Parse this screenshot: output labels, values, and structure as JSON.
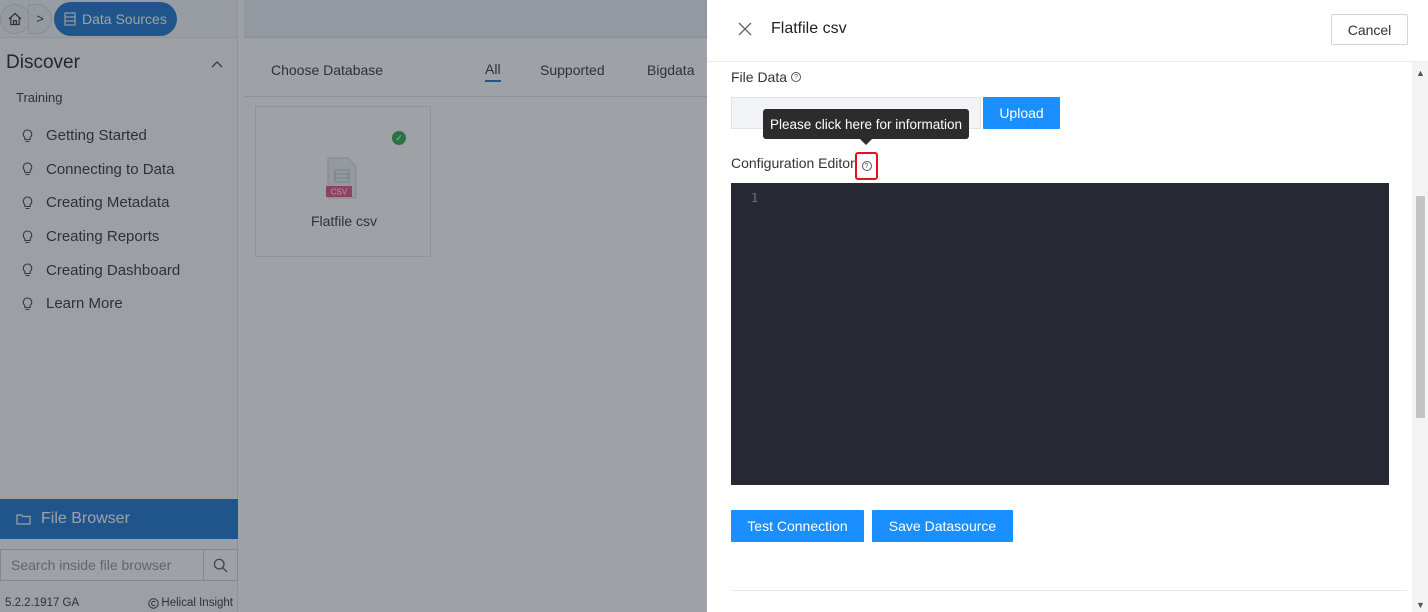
{
  "breadcrumb": {
    "home_icon": "home-icon",
    "arrow": ">",
    "current": "Data Sources",
    "current_icon": "database-icon"
  },
  "sidebar": {
    "section_title": "Discover",
    "section_group": "Training",
    "items": [
      {
        "label": "Getting Started",
        "icon": "lightbulb-icon"
      },
      {
        "label": "Connecting to Data",
        "icon": "lightbulb-icon"
      },
      {
        "label": "Creating Metadata",
        "icon": "lightbulb-icon"
      },
      {
        "label": "Creating Reports",
        "icon": "lightbulb-icon"
      },
      {
        "label": "Creating Dashboard",
        "icon": "lightbulb-icon"
      },
      {
        "label": "Learn More",
        "icon": "lightbulb-icon"
      }
    ],
    "file_browser_label": "File Browser",
    "search_placeholder": "Search inside file browser",
    "version": "5.2.2.1917 GA",
    "copyright": "Helical Insight"
  },
  "main": {
    "choose_label": "Choose Database",
    "tabs": [
      {
        "label": "All",
        "active": true
      },
      {
        "label": "Supported"
      },
      {
        "label": "Bigdata"
      }
    ],
    "cards": [
      {
        "label": "Flatfile csv",
        "icon_text": "CSV",
        "selected": true
      }
    ]
  },
  "drawer": {
    "title": "Flatfile csv",
    "cancel_label": "Cancel",
    "file_data_label": "File Data",
    "upload_label": "Upload",
    "tooltip_text": "Please click here for information",
    "config_label": "Configuration Editor",
    "editor_line_number": "1",
    "test_connection_label": "Test Connection",
    "save_datasource_label": "Save Datasource"
  },
  "colors": {
    "accent": "#1a74d0",
    "button": "#1a8fff",
    "editor_bg": "#272a35",
    "highlight": "#e0131c",
    "success": "#2fa84f"
  }
}
